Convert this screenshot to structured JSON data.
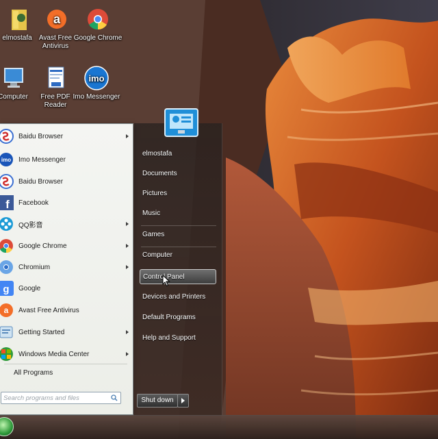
{
  "desktop_icons": [
    {
      "id": "elmostafa",
      "label": "elmostafa",
      "icon": "user-folder-icon"
    },
    {
      "id": "avast",
      "label": "Avast Free Antivirus",
      "icon": "avast-icon"
    },
    {
      "id": "google-chrome",
      "label": "Google Chrome",
      "icon": "chrome-icon"
    },
    {
      "id": "computer",
      "label": "Computer",
      "icon": "computer-icon"
    },
    {
      "id": "free-pdf",
      "label": "Free PDF Reader",
      "icon": "pdf-reader-icon"
    },
    {
      "id": "imo",
      "label": "Imo Messenger",
      "icon": "imo-icon"
    }
  ],
  "start_menu": {
    "programs": [
      {
        "label": "Baidu Browser",
        "icon": "baidu-icon",
        "has_submenu": true
      },
      {
        "label": "Imo Messenger",
        "icon": "imo-icon",
        "has_submenu": false
      },
      {
        "label": "Baidu Browser",
        "icon": "baidu-icon",
        "has_submenu": false
      },
      {
        "label": "Facebook",
        "icon": "facebook-icon",
        "has_submenu": false
      },
      {
        "label": "QQ影音",
        "icon": "qq-player-icon",
        "has_submenu": true
      },
      {
        "label": "Google Chrome",
        "icon": "chrome-icon",
        "has_submenu": true
      },
      {
        "label": "Chromium",
        "icon": "chromium-icon",
        "has_submenu": true
      },
      {
        "label": "Google",
        "icon": "google-icon",
        "has_submenu": false
      },
      {
        "label": "Avast Free Antivirus",
        "icon": "avast-icon",
        "has_submenu": false
      },
      {
        "label": "Getting Started",
        "icon": "getting-started-icon",
        "has_submenu": true
      },
      {
        "label": "Windows Media Center",
        "icon": "media-center-icon",
        "has_submenu": true
      }
    ],
    "all_programs_label": "All Programs",
    "search_placeholder": "Search programs and files",
    "right_items": {
      "user": "elmostafa",
      "documents": "Documents",
      "pictures": "Pictures",
      "music": "Music",
      "games": "Games",
      "computer": "Computer",
      "control_panel": "Control Panel",
      "devices": "Devices and Printers",
      "default_programs": "Default Programs",
      "help": "Help and Support"
    },
    "shutdown_label": "Shut down",
    "hovered_item": "Control Panel"
  },
  "colors": {
    "menu_left_bg": "#eef0ea",
    "menu_right_bg": "#2e2624",
    "hover_border": "#c9c9c9"
  }
}
